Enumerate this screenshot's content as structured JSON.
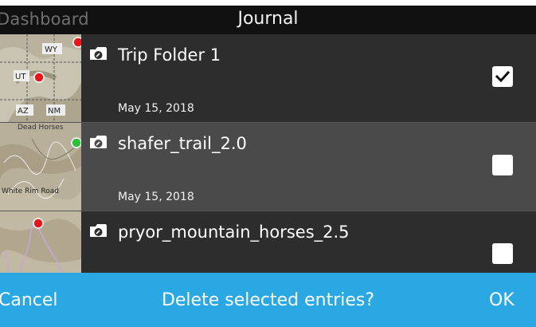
{
  "header": {
    "back_label": "Dashboard",
    "title": "Journal"
  },
  "entries": [
    {
      "name": "Trip Folder 1",
      "date": "May 15, 2018",
      "checked": true,
      "thumbnail_labels": [
        "WY",
        "UT",
        "AZ",
        "NM"
      ],
      "marker_color": "#e8151b"
    },
    {
      "name": "shafer_trail_2.0",
      "date": "May 15, 2018",
      "checked": false,
      "thumbnail_labels": [
        "Dead Horses",
        "White Rim Road"
      ],
      "marker_color": "#2fbf3a"
    },
    {
      "name": "pryor_mountain_horses_2.5",
      "date": "",
      "checked": false,
      "thumbnail_labels": [],
      "marker_color": "#e8151b"
    }
  ],
  "action_bar": {
    "cancel_label": "Cancel",
    "prompt": "Delete selected entries?",
    "ok_label": "OK",
    "color": "#29a8e3"
  },
  "icons": {
    "folder": "folder-icon",
    "check": "checkmark-icon"
  }
}
